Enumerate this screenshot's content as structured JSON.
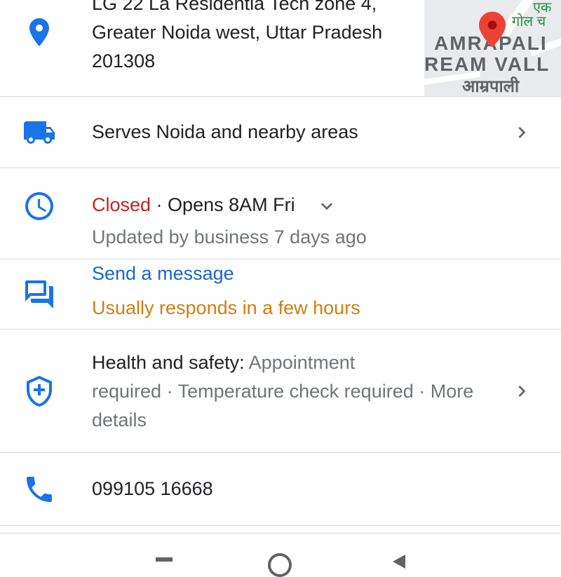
{
  "address": {
    "line1": "LG 22 La Residentia Tech zone 4,",
    "line2": "Greater Noida west, Uttar Pradesh",
    "line3": "201308",
    "map_labels": {
      "hindi_top": "एक",
      "hindi_small": "गोल च",
      "main1": "AMRAPALI",
      "main2": "REAM VALL",
      "hindi_bottom": "आम्रपाली"
    }
  },
  "service_area": {
    "text": "Serves Noida and nearby areas"
  },
  "hours": {
    "status": "Closed",
    "separator": " · ",
    "opens": "Opens 8AM Fri",
    "updated": "Updated by business 7 days ago"
  },
  "message": {
    "action": "Send a message",
    "response": "Usually responds in a few hours"
  },
  "health": {
    "label": "Health and safety:",
    "line1_details": " Appointment",
    "line2": "required · Temperature check required · More",
    "line3": "details"
  },
  "phone": {
    "number": "099105 16668"
  },
  "colors": {
    "icon_blue": "#1a73e8",
    "closed_red": "#c5221f",
    "link_blue": "#1a66c7",
    "response_orange": "#d17d10",
    "pin_red": "#ea4335"
  },
  "icons": {
    "address": "location-pin-icon",
    "service": "delivery-truck-icon",
    "hours": "clock-icon",
    "message": "message-bubbles-icon",
    "health": "shield-plus-icon",
    "phone": "phone-icon"
  }
}
